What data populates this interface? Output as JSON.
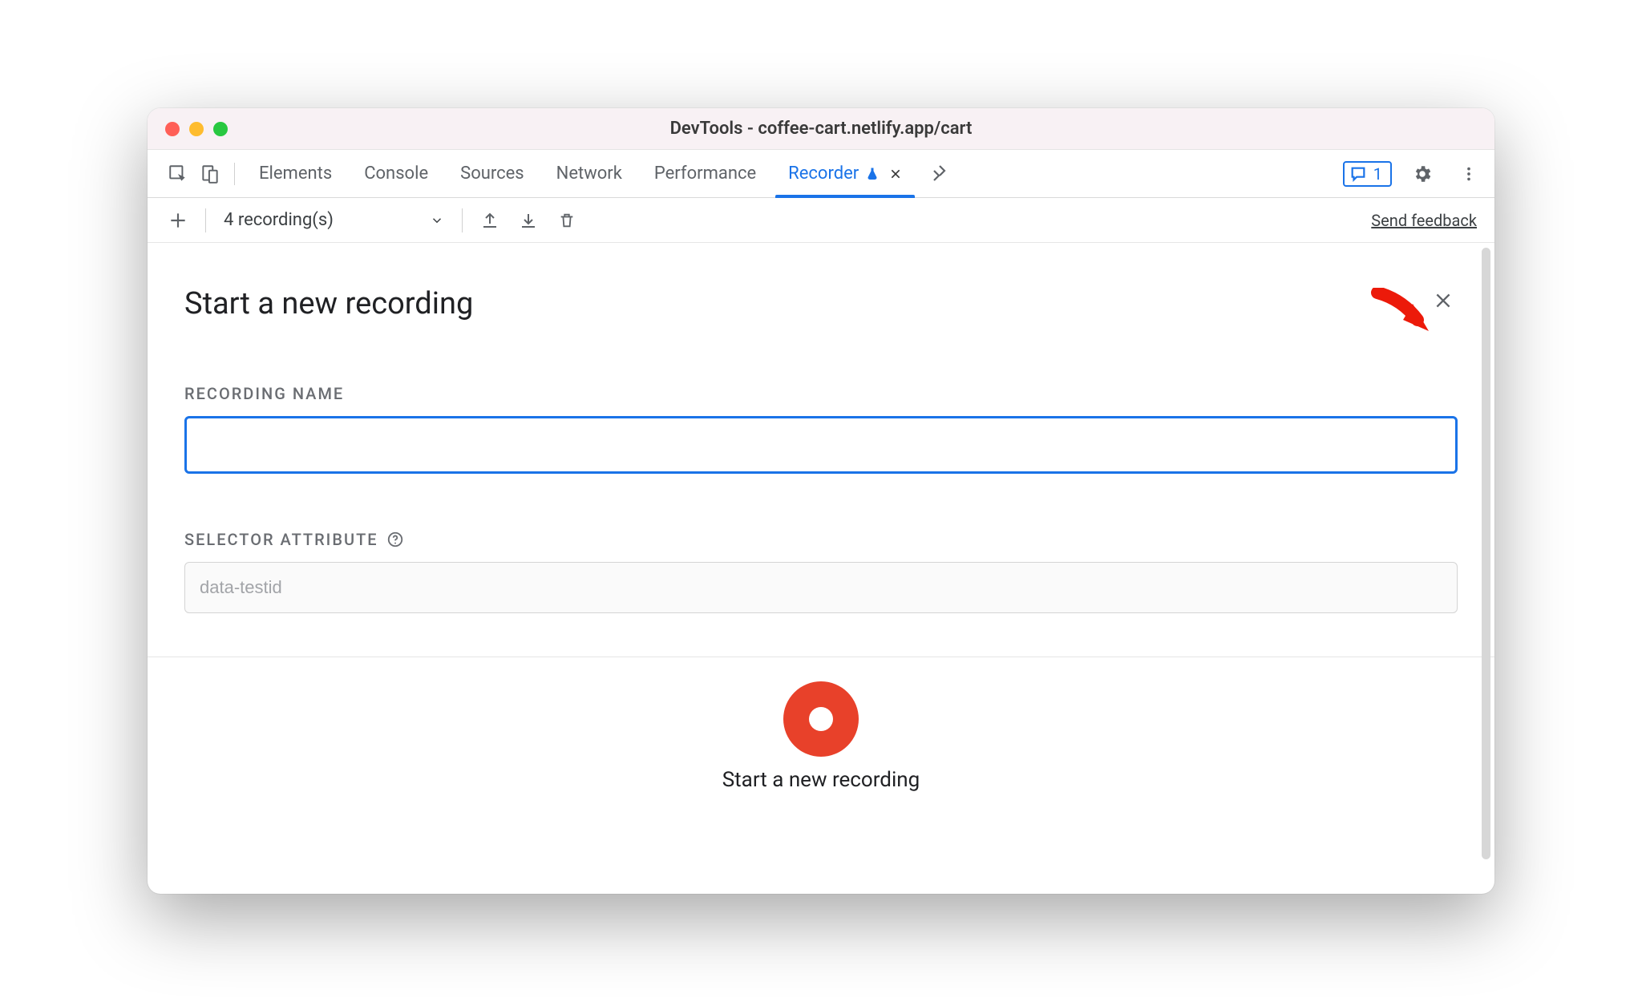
{
  "window": {
    "title": "DevTools - coffee-cart.netlify.app/cart"
  },
  "tabs": {
    "items": [
      "Elements",
      "Console",
      "Sources",
      "Network",
      "Performance",
      "Recorder"
    ],
    "active": "Recorder",
    "issues_count": "1"
  },
  "toolbar": {
    "dropdown_label": "4 recording(s)",
    "feedback_label": "Send feedback"
  },
  "panel": {
    "title": "Start a new recording",
    "recording_name_label": "RECORDING NAME",
    "recording_name_value": "",
    "selector_attr_label": "SELECTOR ATTRIBUTE",
    "selector_attr_placeholder": "data-testid",
    "selector_attr_value": "",
    "start_label": "Start a new recording"
  }
}
